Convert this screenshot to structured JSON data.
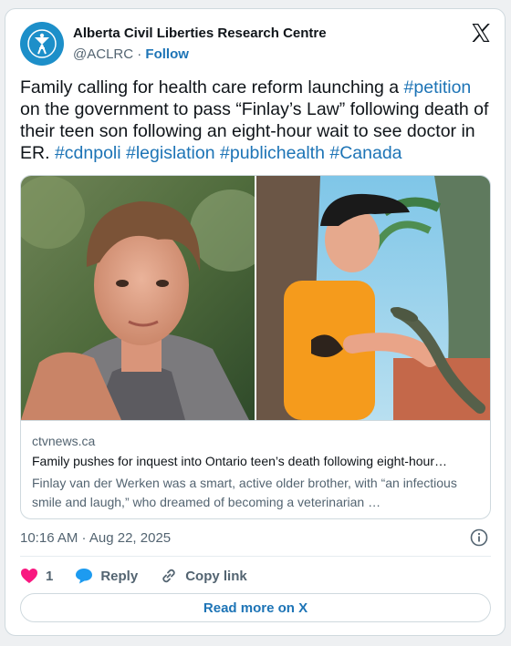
{
  "author": {
    "name": "Alberta Civil Liberties Research Centre",
    "handle": "@ACLRC",
    "separator": "·",
    "follow_label": "Follow"
  },
  "tweet": {
    "text_parts": {
      "p1": "Family calling for health care reform launching a ",
      "tag_petition": "#petition",
      "p2": " on the government to pass “Finlay’s Law” following death of their teen son following an eight-hour wait to see doctor in ER. ",
      "tag_cdnpoli": "#cdnpoli",
      "tag_legislation": "#legislation",
      "tag_publichealth": "#publichealth",
      "tag_canada": "#Canada"
    }
  },
  "link_card": {
    "domain": "ctvnews.ca",
    "title": "Family pushes for inquest into Ontario teen’s death following eight-hour…",
    "description": "Finlay van der Werken was a smart, active older brother, with “an infectious smile and laugh,” who dreamed of becoming a veterinarian …"
  },
  "timestamp": "10:16 AM · Aug 22, 2025",
  "actions": {
    "like_count": "1",
    "reply_label": "Reply",
    "copy_link_label": "Copy link"
  },
  "read_more_label": "Read more on X",
  "colors": {
    "link": "#1d74b6",
    "like": "#f91880",
    "reply": "#1d9bf0",
    "avatar": "#1d8fc9"
  },
  "icons": [
    "aclrc-logo-icon",
    "x-logo-icon",
    "info-icon",
    "heart-icon",
    "reply-bubble-icon",
    "link-icon"
  ]
}
